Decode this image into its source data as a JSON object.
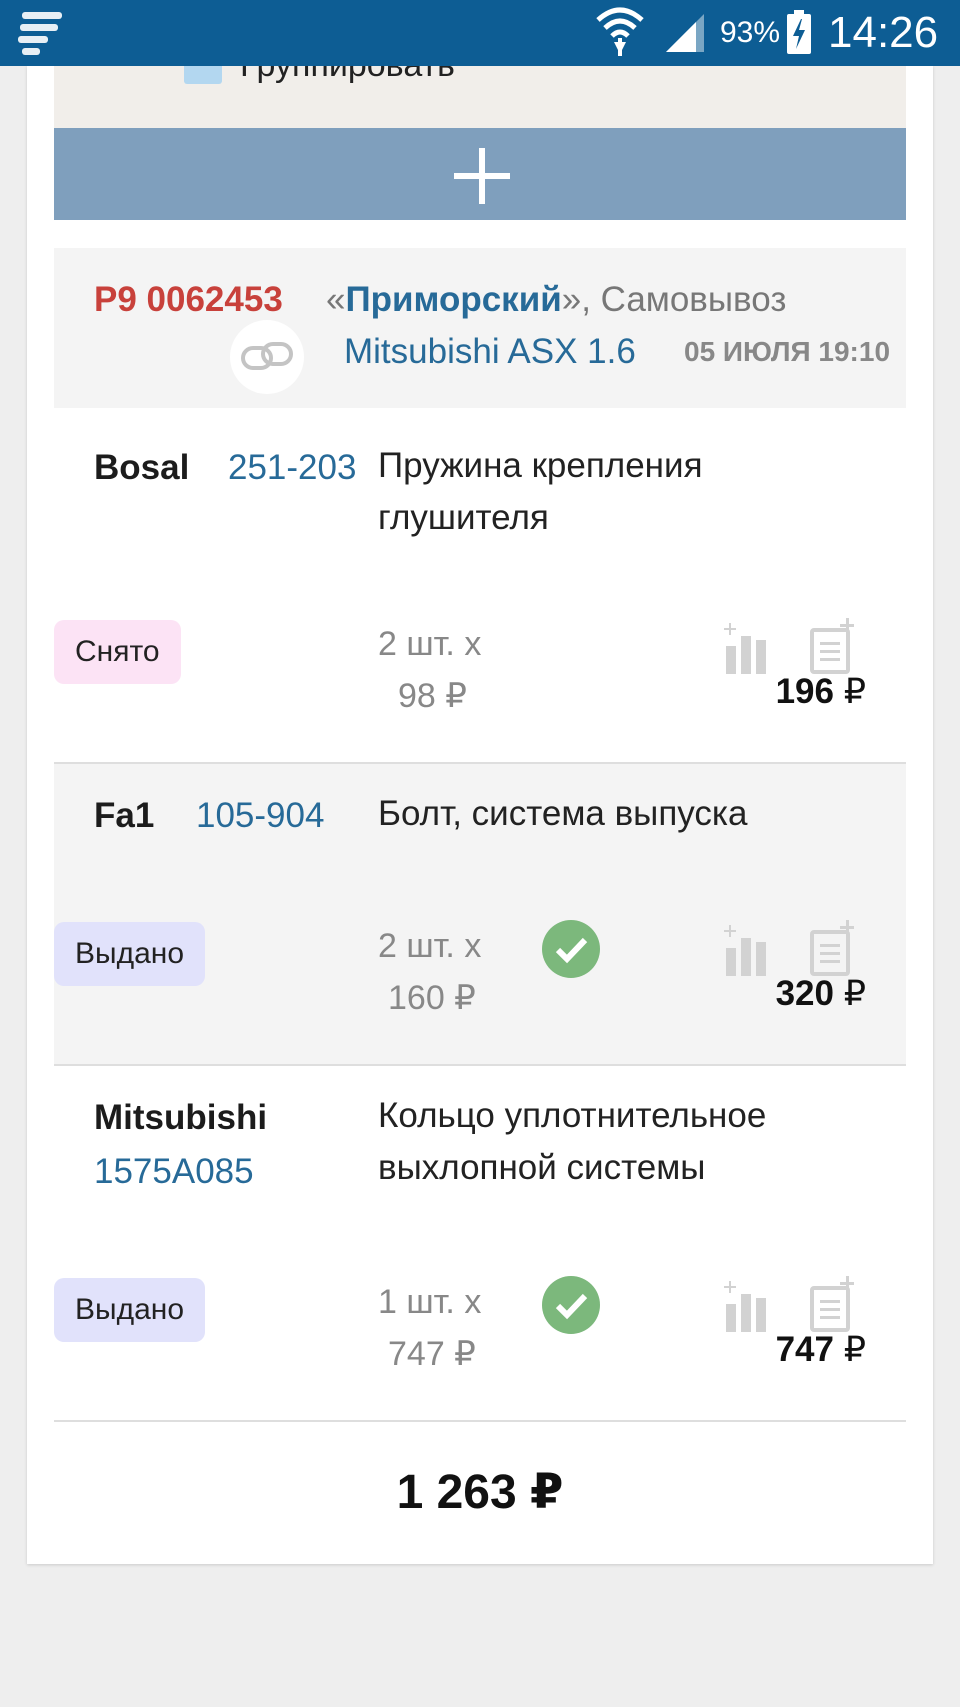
{
  "status_bar": {
    "battery": "93%",
    "time": "14:26",
    "icons": [
      "app-logo-icon",
      "wifi-icon",
      "signal-icon",
      "battery-charging-icon"
    ]
  },
  "group_label": "Группировать",
  "order": {
    "number": "Р9 0062453",
    "store_open": "«",
    "store": "Приморский",
    "store_close": "», Самовывоз",
    "car": "Mitsubishi ASX 1.6",
    "date": "05 ИЮЛЯ 19:10"
  },
  "items": [
    {
      "brand": "Bosal",
      "code": "251-203",
      "description": "Пружина крепления глушителя",
      "status": "Снято",
      "qty": "2 шт. x",
      "unit_price": "98 ₽",
      "total": "196",
      "currency": "₽",
      "checked": false
    },
    {
      "brand": "Fa1",
      "code": "105-904",
      "description": "Болт, система выпуска",
      "status": "Выдано",
      "qty": "2 шт. x",
      "unit_price": "160 ₽",
      "total": "320",
      "currency": "₽",
      "checked": true
    },
    {
      "brand": "Mitsubishi",
      "code": "1575A085",
      "description": "Кольцо уплотнительное выхлопной системы",
      "status": "Выдано",
      "qty": "1 шт. x",
      "unit_price": "747 ₽",
      "total": "747",
      "currency": "₽",
      "checked": true
    }
  ],
  "grand_total": "1 263 ₽",
  "colors": {
    "status_bar": "#0d5d94",
    "add_button": "#7f9fbd",
    "order_number": "#c8413b",
    "link": "#276a98",
    "check": "#7cb87c",
    "status_removed": "#fce3f5",
    "status_issued": "#e1e2fb"
  }
}
